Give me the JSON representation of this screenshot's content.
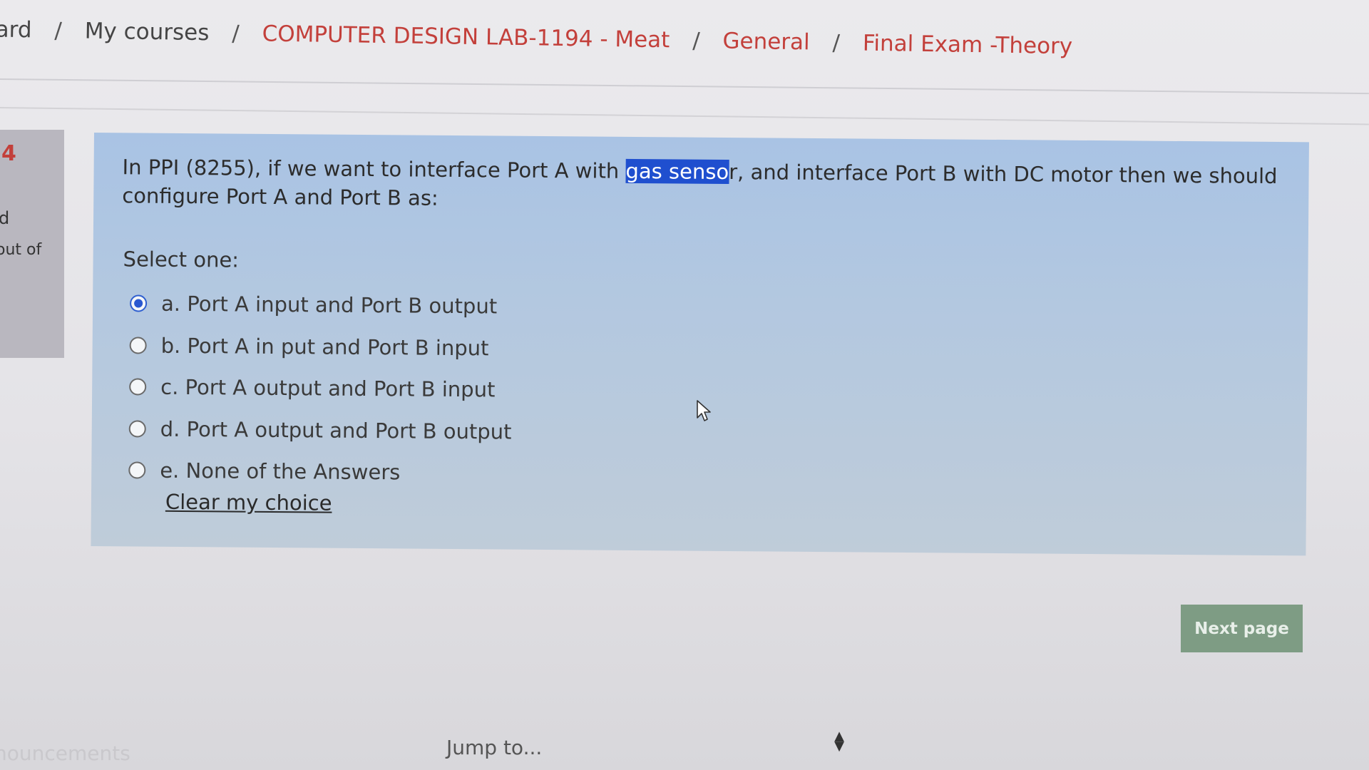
{
  "breadcrumb": {
    "items": [
      "ard",
      "My courses",
      "COMPUTER DESIGN LAB-1194 - Meat",
      "General",
      "Final Exam -Theory"
    ],
    "separator": "/"
  },
  "question_info": {
    "number": "4",
    "state": "d",
    "grade_label": "out of"
  },
  "question": {
    "text_before": "In PPI (8255), if we want to interface Port A with ",
    "text_highlighted": "gas senso",
    "text_after": "r, and interface Port B with DC motor then we should configure Port A and Port B as:",
    "select_label": "Select one:",
    "answers": [
      {
        "label": "a. Port A input and Port B output",
        "checked": true
      },
      {
        "label": "b. Port A in put and Port B input",
        "checked": false
      },
      {
        "label": "c. Port A output and Port B input",
        "checked": false
      },
      {
        "label": "d. Port A output and Port B output",
        "checked": false
      },
      {
        "label": "e. None of the Answers",
        "checked": false
      }
    ],
    "clear_label": "Clear my choice"
  },
  "navigation": {
    "next_label": "Next page"
  },
  "footer": {
    "announcements_label": "nouncements",
    "jump_placeholder": "Jump to..."
  },
  "colors": {
    "link": "#c3403b",
    "highlight": "#1f4fcf",
    "card": "#b3c8e0",
    "button": "#7e9c84"
  }
}
